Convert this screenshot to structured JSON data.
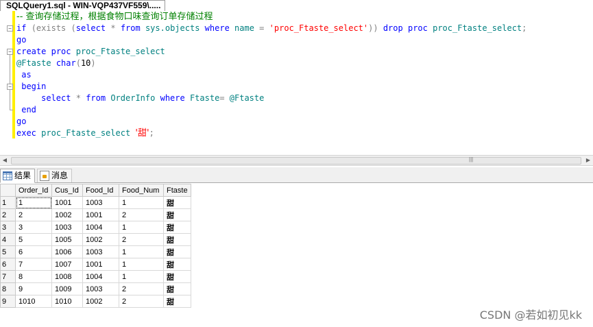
{
  "tab": {
    "title": "SQLQuery1.sql - WIN-VQP437VF559\\....."
  },
  "code": {
    "comment": "-- 查询存储过程，根据食物口味查询订单存储过程",
    "proc_name": "proc_Ftaste_select",
    "proc_string": "'proc_Ftaste_select'",
    "param": "@Ftaste",
    "param_type": "char",
    "param_len": "10",
    "table": "OrderInfo",
    "column": "Ftaste",
    "sys_objects": "sys.objects",
    "exec_arg": "'甜'",
    "kw_if": "if",
    "kw_exists": "exists",
    "kw_select": "select",
    "kw_from": "from",
    "kw_where": "where",
    "kw_name": "name",
    "kw_drop": "drop",
    "kw_proc": "proc",
    "kw_go": "go",
    "kw_create": "create",
    "kw_as": "as",
    "kw_begin": "begin",
    "kw_end": "end",
    "kw_exec": "exec",
    "star": "*"
  },
  "result_tabs": [
    {
      "label": "结果",
      "icon": "grid-icon"
    },
    {
      "label": "消息",
      "icon": "message-icon"
    }
  ],
  "results": {
    "columns": [
      "Order_Id",
      "Cus_Id",
      "Food_Id",
      "Food_Num",
      "Ftaste"
    ],
    "rows": [
      [
        "1",
        "1",
        "1001",
        "1003",
        "1",
        "甜"
      ],
      [
        "2",
        "2",
        "1002",
        "1001",
        "2",
        "甜"
      ],
      [
        "3",
        "3",
        "1003",
        "1004",
        "1",
        "甜"
      ],
      [
        "4",
        "5",
        "1005",
        "1002",
        "2",
        "甜"
      ],
      [
        "5",
        "6",
        "1006",
        "1003",
        "1",
        "甜"
      ],
      [
        "6",
        "7",
        "1007",
        "1001",
        "1",
        "甜"
      ],
      [
        "7",
        "8",
        "1008",
        "1004",
        "1",
        "甜"
      ],
      [
        "8",
        "9",
        "1009",
        "1003",
        "2",
        "甜"
      ],
      [
        "9",
        "1010",
        "1010",
        "1002",
        "2",
        "甜"
      ]
    ]
  },
  "watermark": "CSDN @若如初见kk"
}
